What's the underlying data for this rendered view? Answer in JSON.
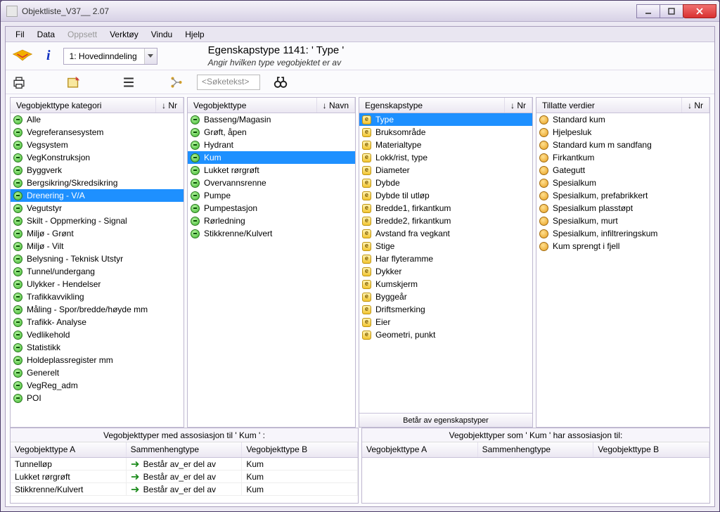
{
  "window": {
    "title": "Objektliste_V37__ 2.07"
  },
  "menu": {
    "items": [
      "Fil",
      "Data",
      "Oppsett",
      "Verktøy",
      "Vindu",
      "Hjelp"
    ],
    "disabled_index": 2
  },
  "combo": {
    "selected": "1: Hovedinndeling"
  },
  "header": {
    "title": "Egenskapstype 1141:  ' Type '",
    "subtitle": "Angir hvilken type vegobjektet er av"
  },
  "search": {
    "placeholder": "<Søketekst>"
  },
  "panels": {
    "category": {
      "header": "Vegobjekttype kategori",
      "sort": "↓ Nr",
      "selected_index": 6,
      "items": [
        "Alle",
        "Vegreferansesystem",
        "Vegsystem",
        "VegKonstruksjon",
        "Byggverk",
        "Bergsikring/Skredsikring",
        "Drenering - V/A",
        "Vegutstyr",
        "Skilt - Oppmerking - Signal",
        "Miljø - Grønt",
        "Miljø - Vilt",
        "Belysning - Teknisk Utstyr",
        "Tunnel/undergang",
        "Ulykker - Hendelser",
        "Trafikkavvikling",
        "Måling - Spor/bredde/høyde mm",
        "Trafikk-  Analyse",
        "Vedlikehold",
        "Statistikk",
        "Holdeplassregister mm",
        "Generelt",
        "VegReg_adm",
        "POI"
      ]
    },
    "object": {
      "header": "Vegobjekttype",
      "sort": "↓ Navn",
      "selected_index": 3,
      "items": [
        "Basseng/Magasin",
        "Grøft, åpen",
        "Hydrant",
        "Kum",
        "Lukket rørgrøft",
        "Overvannsrenne",
        "Pumpe",
        "Pumpestasjon",
        "Rørledning",
        "Stikkrenne/Kulvert"
      ]
    },
    "property": {
      "header": "Egenskapstype",
      "sort": "↓ Nr",
      "selected_index": 0,
      "items": [
        "Type",
        "Bruksområde",
        "Materialtype",
        "Lokk/rist, type",
        "Diameter",
        "Dybde",
        "Dybde til utløp",
        "Bredde1, firkantkum",
        "Bredde2, firkantkum",
        "Avstand fra vegkant",
        "Stige",
        "Har flyteramme",
        "Dykker",
        "Kumskjerm",
        "Byggeår",
        "Driftsmerking",
        "Eier",
        "Geometri, punkt"
      ],
      "footer": "Betår av egenskapstyper"
    },
    "values": {
      "header": "Tillatte verdier",
      "sort": "↓ Nr",
      "items": [
        "Standard kum",
        "Hjelpesluk",
        "Standard kum m sandfang",
        "Firkantkum",
        "Gategutt",
        "Spesialkum",
        "Spesialkum, prefabrikkert",
        "Spesialkum plasstøpt",
        "Spesialkum, murt",
        "Spesialkum, infiltreringskum",
        "Kum sprengt i fjell"
      ]
    }
  },
  "bottom": {
    "left": {
      "title": "Vegobjekttyper med assosiasjon til ' Kum ' :",
      "columns": [
        "Vegobjekttype A",
        "Sammenhengtype",
        "Vegobjekttype B"
      ],
      "rows": [
        {
          "a": "Tunnelløp",
          "rel": "Består av_er del av",
          "b": "Kum"
        },
        {
          "a": "Lukket rørgrøft",
          "rel": "Består av_er del av",
          "b": "Kum"
        },
        {
          "a": "Stikkrenne/Kulvert",
          "rel": "Består av_er del av",
          "b": "Kum"
        }
      ]
    },
    "right": {
      "title": "Vegobjekttyper som ' Kum ' har assosiasjon til:",
      "columns": [
        "Vegobjekttype A",
        "Sammenhengtype",
        "Vegobjekttype B"
      ],
      "rows": []
    }
  }
}
